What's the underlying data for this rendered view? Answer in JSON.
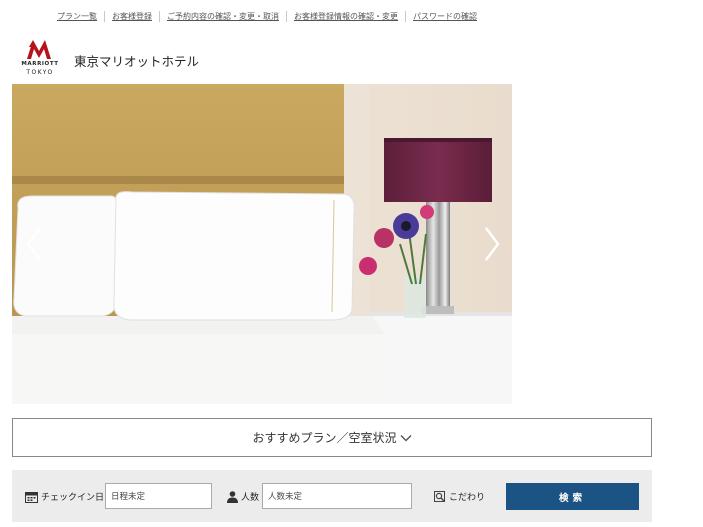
{
  "top_nav": {
    "links": [
      "プラン一覧",
      "お客様登録",
      "ご予約内容の確認・変更・取消",
      "お客様登録情報の確認・変更",
      "パスワードの確認"
    ]
  },
  "header": {
    "logo_brand": "MARRIOTT",
    "logo_city": "TOKYO",
    "hotel_name": "東京マリオットホテル"
  },
  "carousel": {
    "image": "hotel-room-bed-lamp",
    "prev_icon": "chevron-left-icon",
    "next_icon": "chevron-right-icon"
  },
  "plans_bar": {
    "label": "おすすめプラン／空室状況",
    "icon": "chevron-down-icon"
  },
  "search": {
    "checkin_label": "チェックイン日",
    "checkin_value": "日程未定",
    "guests_label": "人数",
    "guests_value": "人数未定",
    "preference_label": "こだわり",
    "button_label": "検索"
  },
  "colors": {
    "brand_red": "#b5121b",
    "button_blue": "#1b5384",
    "search_bg": "#ececec"
  }
}
